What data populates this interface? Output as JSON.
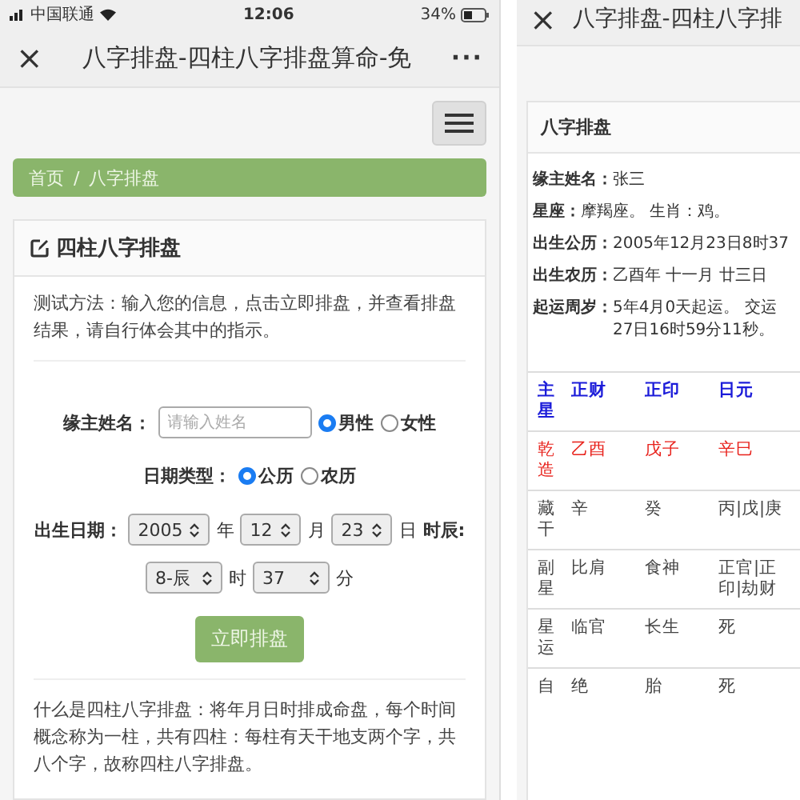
{
  "left": {
    "status_bar": {
      "carrier": "中国联通",
      "time": "12:06",
      "battery": "34%"
    },
    "title_bar": {
      "close": "×",
      "title": "八字排盘-四柱八字排盘算命-免",
      "more": "···"
    },
    "breadcrumb": {
      "items": [
        {
          "label": "首页"
        },
        {
          "label": "八字排盘"
        }
      ],
      "separator": "/"
    },
    "card": {
      "title": "四柱八字排盘",
      "instructions": "测试方法：输入您的信息，点击立即排盘，并查看排盘结果，请自行体会其中的指示。",
      "name_label": "缘主姓名：",
      "name_field": {
        "placeholder": "请输入姓名"
      },
      "genders": [
        {
          "label": "男性",
          "selected": true
        },
        {
          "label": "女性",
          "selected": false
        }
      ],
      "date_type_label": "日期类型：",
      "date_types": [
        {
          "label": "公历",
          "selected": true
        },
        {
          "label": "农历",
          "selected": false
        }
      ],
      "birth_label": "出生日期：",
      "date_selects": [
        {
          "value": "2005",
          "unit": "年"
        },
        {
          "value": "12",
          "unit": "月"
        },
        {
          "value": "23",
          "unit": "日"
        }
      ],
      "time_label": "时辰:",
      "time_selects": [
        {
          "value": "8-辰",
          "unit": "时"
        },
        {
          "value": "37",
          "unit": "分"
        }
      ],
      "submit": "立即排盘",
      "explanation": "什么是四柱八字排盘：将年月日时排成命盘，每个时间概念称为一柱，共有四柱：每柱有天干地支两个字，共八个字，故称四柱八字排盘。"
    }
  },
  "right": {
    "title_bar": {
      "close": "×",
      "title": "八字排盘-四柱八字排"
    },
    "card": {
      "title": "八字排盘",
      "info": [
        {
          "label": "缘主姓名：",
          "lines": [
            "张三"
          ]
        },
        {
          "label": "星座：",
          "lines": [
            "摩羯座。 生肖：鸡。"
          ]
        },
        {
          "label": "出生公历：",
          "lines": [
            "2005年12月23日8时37"
          ]
        },
        {
          "label": "出生农历：",
          "lines": [
            "乙酉年 十一月 廿三日"
          ]
        },
        {
          "label": "起运周岁：",
          "lines": [
            "5年4月0天起运。 交运",
            "27日16时59分11秒。"
          ]
        }
      ],
      "table": [
        {
          "kind": "header",
          "cells": [
            "主星",
            "正财",
            "正印",
            "日元"
          ]
        },
        {
          "kind": "pillar",
          "cells": [
            "乾造",
            "乙酉",
            "戊子",
            "辛巳"
          ]
        },
        {
          "kind": "plain",
          "cells": [
            "藏干",
            "辛",
            "癸",
            "丙|戊|庚"
          ]
        },
        {
          "kind": "plain",
          "cells": [
            "副星",
            "比肩",
            "食神",
            "正官|正印|劫财"
          ]
        },
        {
          "kind": "plain",
          "cells": [
            "星运",
            "临官",
            "长生",
            "死"
          ]
        },
        {
          "kind": "plain",
          "cells": [
            "自",
            "绝",
            "胎",
            "死"
          ]
        }
      ]
    }
  }
}
